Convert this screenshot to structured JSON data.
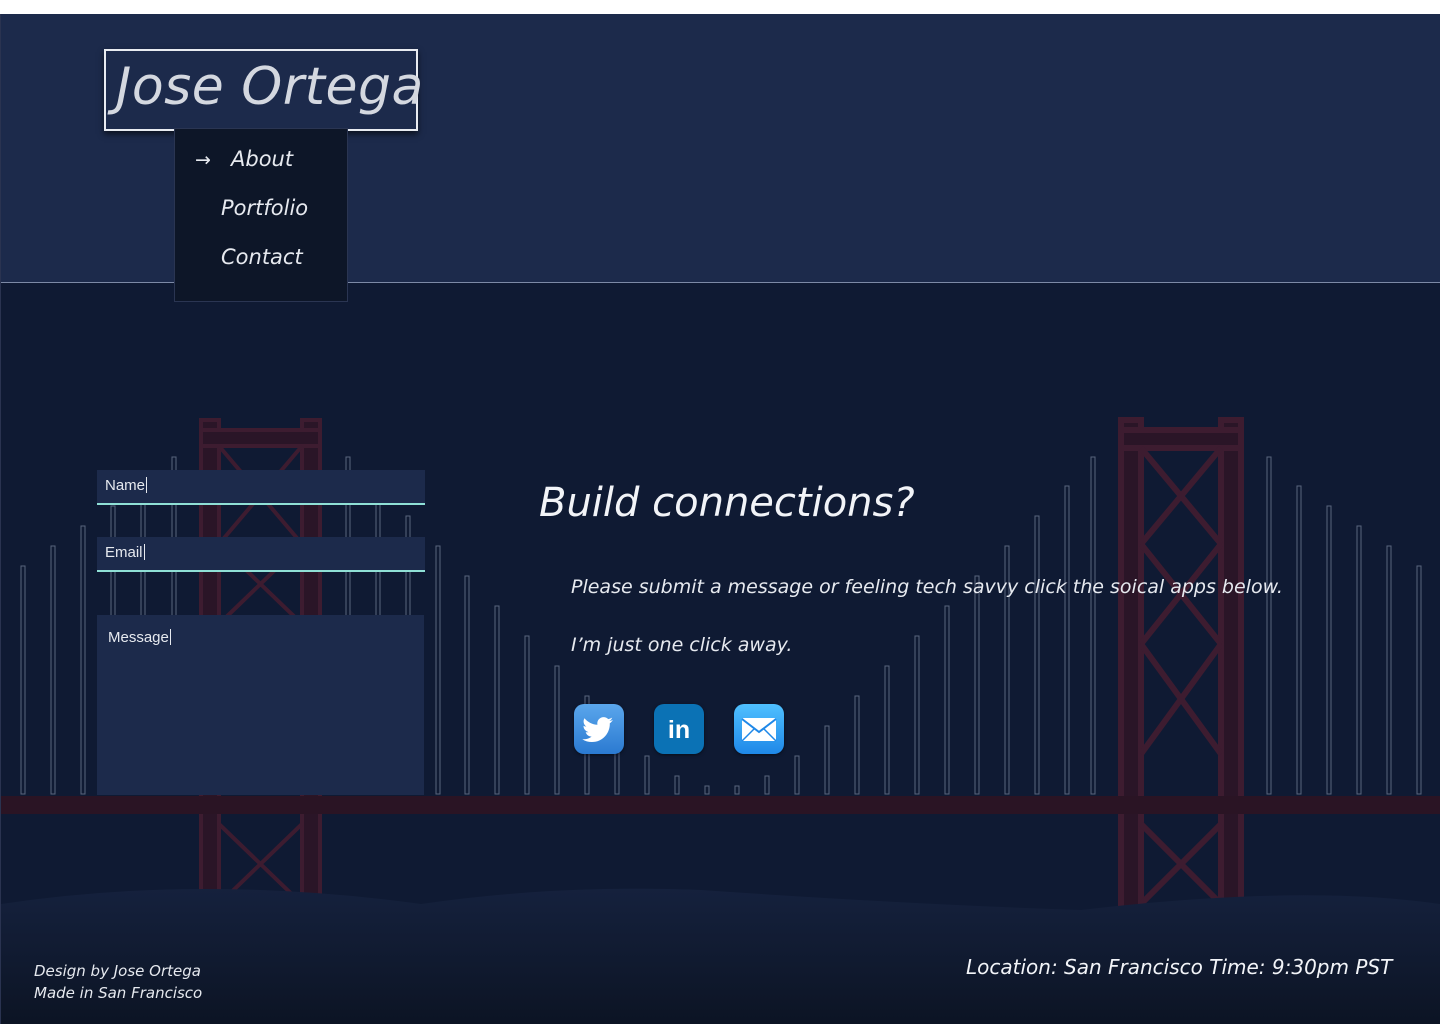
{
  "header": {
    "logo": "Jose Ortega",
    "nav": [
      {
        "label": "About",
        "active": true
      },
      {
        "label": "Portfolio",
        "active": false
      },
      {
        "label": "Contact",
        "active": false
      }
    ]
  },
  "form": {
    "name_placeholder": "Name",
    "email_placeholder": "Email",
    "message_placeholder": "Message"
  },
  "main": {
    "heading": "Build connections?",
    "line1": "Please submit a message or feeling tech savvy click the soical apps below.",
    "line2": "I’m just one click away."
  },
  "social": [
    {
      "name": "twitter",
      "icon": "twitter-icon",
      "color": "#3a8ee0"
    },
    {
      "name": "linkedin",
      "icon": "linkedin-icon",
      "color": "#0b72b5"
    },
    {
      "name": "email",
      "icon": "mail-icon",
      "color": "#2f9ff2"
    }
  ],
  "footer": {
    "design_by": "Design by Jose Ortega",
    "made_in": "Made in San Francisco",
    "location": "Location: San Francisco Time: 9:30pm PST"
  },
  "colors": {
    "header_bg": "#1c2a4b",
    "page_bg": "#0f1a33",
    "bridge": "#3a1a2e",
    "field_underline": "#8fe0d6"
  }
}
